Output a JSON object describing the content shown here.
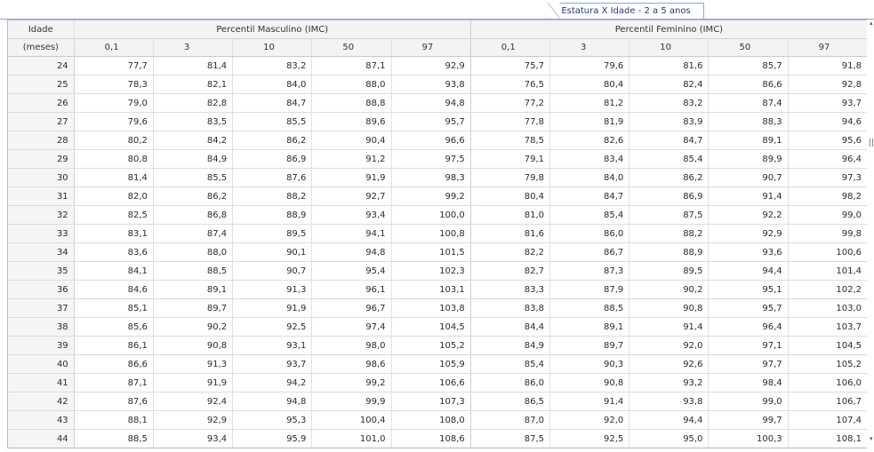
{
  "tab": {
    "label": "Estatura X Idade - 2 a 5 anos"
  },
  "header": {
    "age_label": "Idade",
    "age_unit": "(meses)",
    "male_group": "Percentil Masculino (IMC)",
    "female_group": "Percentil Feminino (IMC)",
    "percentiles": [
      "0,1",
      "3",
      "10",
      "50",
      "97"
    ]
  },
  "rows": [
    {
      "age": "24",
      "m": [
        "77,7",
        "81,4",
        "83,2",
        "87,1",
        "92,9"
      ],
      "f": [
        "75,7",
        "79,6",
        "81,6",
        "85,7",
        "91,8"
      ]
    },
    {
      "age": "25",
      "m": [
        "78,3",
        "82,1",
        "84,0",
        "88,0",
        "93,8"
      ],
      "f": [
        "76,5",
        "80,4",
        "82,4",
        "86,6",
        "92,8"
      ]
    },
    {
      "age": "26",
      "m": [
        "79,0",
        "82,8",
        "84,7",
        "88,8",
        "94,8"
      ],
      "f": [
        "77,2",
        "81,2",
        "83,2",
        "87,4",
        "93,7"
      ]
    },
    {
      "age": "27",
      "m": [
        "79,6",
        "83,5",
        "85,5",
        "89,6",
        "95,7"
      ],
      "f": [
        "77,8",
        "81,9",
        "83,9",
        "88,3",
        "94,6"
      ]
    },
    {
      "age": "28",
      "m": [
        "80,2",
        "84,2",
        "86,2",
        "90,4",
        "96,6"
      ],
      "f": [
        "78,5",
        "82,6",
        "84,7",
        "89,1",
        "95,6"
      ]
    },
    {
      "age": "29",
      "m": [
        "80,8",
        "84,9",
        "86,9",
        "91,2",
        "97,5"
      ],
      "f": [
        "79,1",
        "83,4",
        "85,4",
        "89,9",
        "96,4"
      ]
    },
    {
      "age": "30",
      "m": [
        "81,4",
        "85,5",
        "87,6",
        "91,9",
        "98,3"
      ],
      "f": [
        "79,8",
        "84,0",
        "86,2",
        "90,7",
        "97,3"
      ]
    },
    {
      "age": "31",
      "m": [
        "82,0",
        "86,2",
        "88,2",
        "92,7",
        "99,2"
      ],
      "f": [
        "80,4",
        "84,7",
        "86,9",
        "91,4",
        "98,2"
      ]
    },
    {
      "age": "32",
      "m": [
        "82,5",
        "86,8",
        "88,9",
        "93,4",
        "100,0"
      ],
      "f": [
        "81,0",
        "85,4",
        "87,5",
        "92,2",
        "99,0"
      ]
    },
    {
      "age": "33",
      "m": [
        "83,1",
        "87,4",
        "89,5",
        "94,1",
        "100,8"
      ],
      "f": [
        "81,6",
        "86,0",
        "88,2",
        "92,9",
        "99,8"
      ]
    },
    {
      "age": "34",
      "m": [
        "83,6",
        "88,0",
        "90,1",
        "94,8",
        "101,5"
      ],
      "f": [
        "82,2",
        "86,7",
        "88,9",
        "93,6",
        "100,6"
      ]
    },
    {
      "age": "35",
      "m": [
        "84,1",
        "88,5",
        "90,7",
        "95,4",
        "102,3"
      ],
      "f": [
        "82,7",
        "87,3",
        "89,5",
        "94,4",
        "101,4"
      ]
    },
    {
      "age": "36",
      "m": [
        "84,6",
        "89,1",
        "91,3",
        "96,1",
        "103,1"
      ],
      "f": [
        "83,3",
        "87,9",
        "90,2",
        "95,1",
        "102,2"
      ]
    },
    {
      "age": "37",
      "m": [
        "85,1",
        "89,7",
        "91,9",
        "96,7",
        "103,8"
      ],
      "f": [
        "83,8",
        "88,5",
        "90,8",
        "95,7",
        "103,0"
      ]
    },
    {
      "age": "38",
      "m": [
        "85,6",
        "90,2",
        "92,5",
        "97,4",
        "104,5"
      ],
      "f": [
        "84,4",
        "89,1",
        "91,4",
        "96,4",
        "103,7"
      ]
    },
    {
      "age": "39",
      "m": [
        "86,1",
        "90,8",
        "93,1",
        "98,0",
        "105,2"
      ],
      "f": [
        "84,9",
        "89,7",
        "92,0",
        "97,1",
        "104,5"
      ]
    },
    {
      "age": "40",
      "m": [
        "86,6",
        "91,3",
        "93,7",
        "98,6",
        "105,9"
      ],
      "f": [
        "85,4",
        "90,3",
        "92,6",
        "97,7",
        "105,2"
      ]
    },
    {
      "age": "41",
      "m": [
        "87,1",
        "91,9",
        "94,2",
        "99,2",
        "106,6"
      ],
      "f": [
        "86,0",
        "90,8",
        "93,2",
        "98,4",
        "106,0"
      ]
    },
    {
      "age": "42",
      "m": [
        "87,6",
        "92,4",
        "94,8",
        "99,9",
        "107,3"
      ],
      "f": [
        "86,5",
        "91,4",
        "93,8",
        "99,0",
        "106,7"
      ]
    },
    {
      "age": "43",
      "m": [
        "88,1",
        "92,9",
        "95,3",
        "100,4",
        "108,0"
      ],
      "f": [
        "87,0",
        "92,0",
        "94,4",
        "99,7",
        "107,4"
      ]
    },
    {
      "age": "44",
      "m": [
        "88,5",
        "93,4",
        "95,9",
        "101,0",
        "108,6"
      ],
      "f": [
        "87,5",
        "92,5",
        "95,0",
        "100,3",
        "108,1"
      ]
    }
  ]
}
